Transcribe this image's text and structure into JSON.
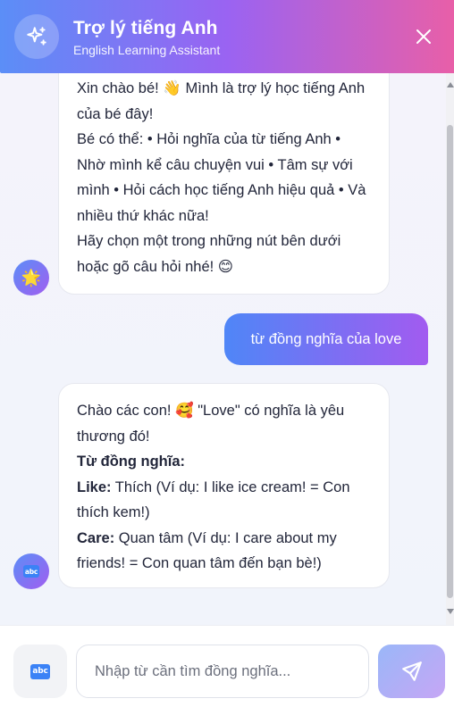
{
  "header": {
    "title": "Trợ lý tiếng Anh",
    "subtitle": "English Learning Assistant",
    "avatar_icon": "sparkles-icon",
    "close_icon": "close-icon"
  },
  "messages": {
    "bot1": {
      "line1": "Xin chào bé! 👋 Mình là trợ lý học tiếng Anh của bé đây!",
      "line2": "Bé có thể: • Hỏi nghĩa của từ tiếng Anh • Nhờ mình kể câu chuyện vui • Tâm sự với mình • Hỏi cách học tiếng Anh hiệu quả • Và nhiều thứ khác nữa!",
      "line3": "Hãy chọn một trong những nút bên dưới hoặc gõ câu hỏi nhé! 😊",
      "avatar": "🌟"
    },
    "user1": {
      "text": "từ đồng nghĩa của love"
    },
    "bot2": {
      "intro": "Chào các con! 🥰 \"Love\" có nghĩa là yêu thương đó!",
      "heading": "Từ đồng nghĩa:",
      "item1_label": "Like:",
      "item1_text": " Thích (Ví dụ: I like ice cream! = Con thích kem!)",
      "item2_label": "Care:",
      "item2_text": " Quan tâm (Ví dụ: I care about my friends! = Con quan tâm đến bạn bè!)",
      "avatar_badge": "abc"
    }
  },
  "input": {
    "mode_badge": "abc",
    "placeholder": "Nhập từ cần tìm đồng nghĩa...",
    "value": "",
    "send_icon": "send-icon"
  },
  "colors": {
    "header_gradient": [
      "#5b8ef7",
      "#9a63f2",
      "#e85fa8"
    ],
    "user_bubble": [
      "#4f86f7",
      "#a25bf0"
    ],
    "send_button": [
      "#9ab7f8",
      "#c6a6f5"
    ]
  }
}
